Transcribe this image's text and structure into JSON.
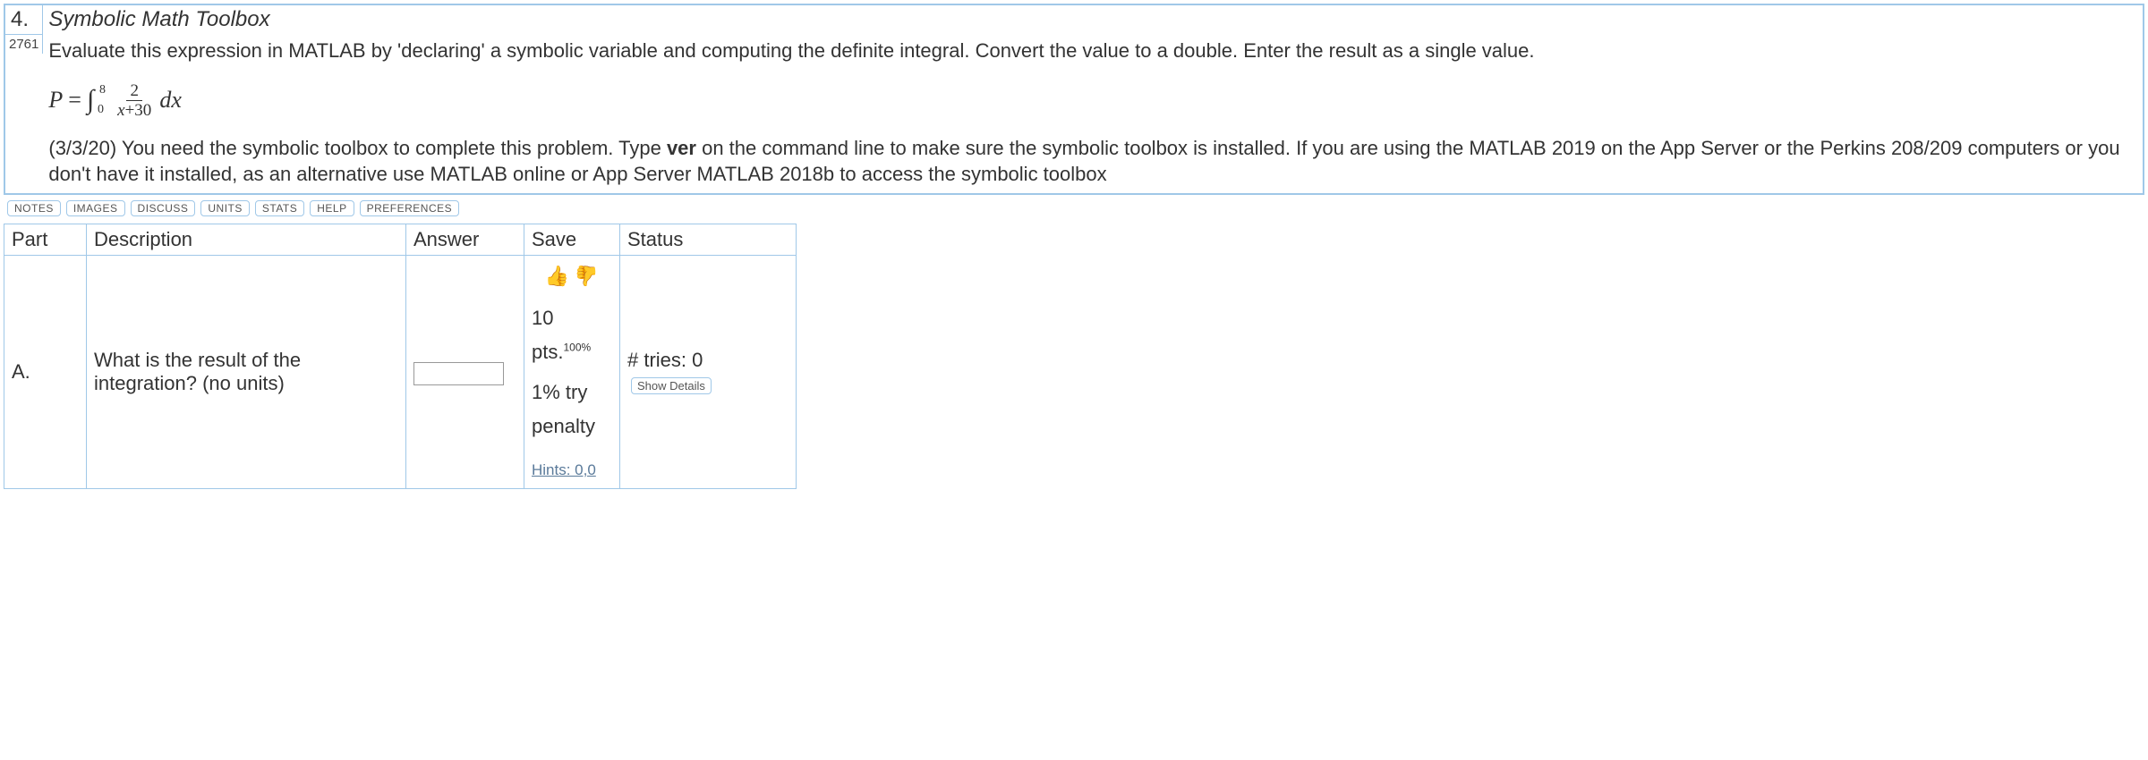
{
  "question": {
    "number": "4.",
    "id": "2761",
    "title": "Symbolic Math Toolbox",
    "prompt": "Evaluate this expression in MATLAB by 'declaring' a symbolic variable and computing the definite integral. Convert the value to a double. Enter the result as a single value.",
    "equation": {
      "lhs": "P",
      "lower": "0",
      "upper": "8",
      "numerator": "2",
      "denom_var": "x",
      "denom_plus": "+30",
      "dx": "dx"
    },
    "note_pre": "(3/3/20) You need the symbolic toolbox to complete this problem. Type ",
    "note_bold": "ver",
    "note_post": " on the command line to make sure the symbolic toolbox is installed. If you are using the MATLAB 2019 on the App Server or the Perkins 208/209 computers or you don't have it installed, as an alternative use MATLAB online or App Server MATLAB 2018b to access the symbolic toolbox"
  },
  "toolbar": [
    "NOTES",
    "IMAGES",
    "DISCUSS",
    "UNITS",
    "STATS",
    "HELP",
    "PREFERENCES"
  ],
  "table": {
    "headers": {
      "part": "Part",
      "description": "Description",
      "answer": "Answer",
      "save": "Save",
      "status": "Status"
    },
    "row": {
      "part": "A.",
      "description": "What is the result of the integration? (no units)",
      "points": "10 pts.",
      "percent": "100%",
      "penalty": "1% try penalty",
      "hints": "Hints: 0,0",
      "tries": "# tries: 0",
      "details": "Show Details"
    }
  }
}
